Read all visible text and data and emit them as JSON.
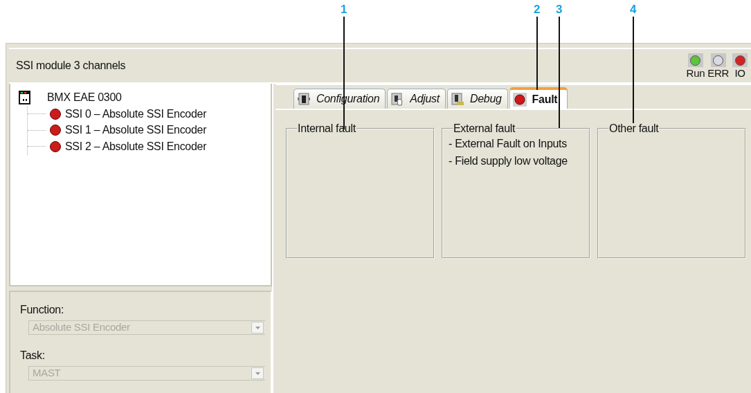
{
  "window": {
    "title": "SSI module 3 channels"
  },
  "leds": [
    {
      "label": "Run",
      "color": "#5ec43c"
    },
    {
      "label": "ERR",
      "color": "#dadae2"
    },
    {
      "label": "IO",
      "color": "#d42222"
    }
  ],
  "tree": {
    "label": "BMX EAE 0300",
    "children": [
      {
        "label": "SSI 0 – Absolute SSI Encoder",
        "color": "#cc1b1b"
      },
      {
        "label": "SSI 1 – Absolute SSI Encoder",
        "color": "#cc1b1b"
      },
      {
        "label": "SSI 2 – Absolute SSI Encoder",
        "color": "#cc1b1b"
      }
    ]
  },
  "fields": [
    {
      "label": "Function:",
      "value": "Absolute SSI Encoder",
      "disabled": true
    },
    {
      "label": "Task:",
      "value": "MAST",
      "disabled": true
    }
  ],
  "tabs": [
    {
      "label": "Configuration",
      "kind": "module",
      "selected": false
    },
    {
      "label": "Adjust",
      "kind": "hand",
      "selected": false
    },
    {
      "label": "Debug",
      "kind": "debug",
      "selected": false
    },
    {
      "label": "Fault",
      "kind": "fault",
      "selected": true
    }
  ],
  "groups": [
    {
      "title": "Internal fault"
    },
    {
      "title": "External fault",
      "lines": [
        "- External Fault on Inputs",
        "- Field supply low voltage"
      ]
    },
    {
      "title": "Other fault"
    }
  ],
  "callouts": [
    {
      "label": "1"
    },
    {
      "label": "2"
    },
    {
      "label": "3"
    },
    {
      "label": "4"
    }
  ]
}
